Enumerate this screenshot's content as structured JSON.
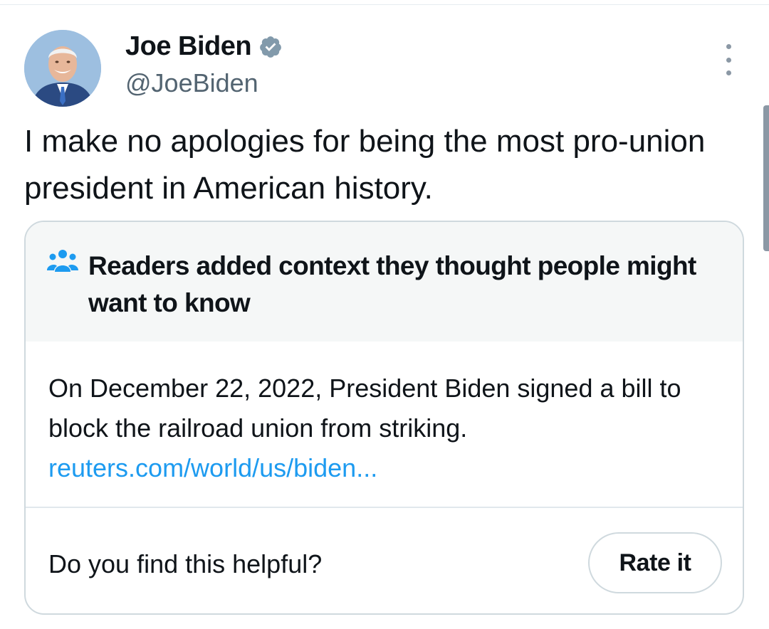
{
  "tweet": {
    "author_name": "Joe Biden",
    "author_handle": "@JoeBiden",
    "text": "I make no apologies for being the most pro-union president in American history."
  },
  "community_note": {
    "title": "Readers added context they thought people might want to know",
    "body": "On December 22, 2022, President Biden signed a bill to block the railroad union from striking.",
    "link": "reuters.com/world/us/biden...",
    "question": "Do you find this helpful?",
    "rate_label": "Rate it"
  },
  "colors": {
    "link": "#1d9bf0",
    "secondary_text": "#536471",
    "verified_badge": "#829aab",
    "note_header_bg": "#f5f7f7",
    "people_icon": "#1d9bf0"
  },
  "icons": [
    "verified-badge-icon",
    "more-options-icon",
    "people-icon"
  ]
}
